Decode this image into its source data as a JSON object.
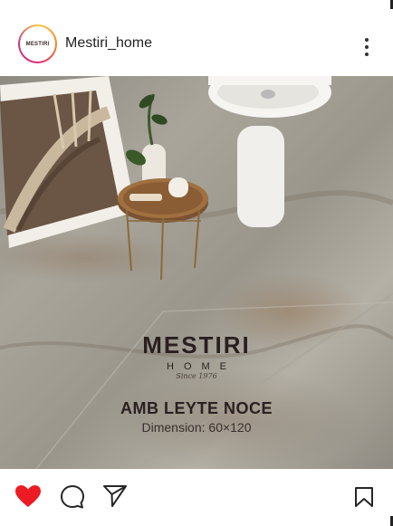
{
  "header": {
    "avatar_text": "MESTIRI",
    "username": "Mestiri_home",
    "more_icon": "more-vertical-icon"
  },
  "post": {
    "brand_name": "MESTIRI",
    "brand_sub": "HOME",
    "brand_since": "Since 1976",
    "product_name": "AMB LEYTE NOCE",
    "product_dimension": "Dimension: 60×120"
  },
  "actions": {
    "like_icon": "heart-filled-icon",
    "comment_icon": "comment-icon",
    "share_icon": "send-icon",
    "save_icon": "bookmark-icon",
    "like_color": "#ed1c24"
  }
}
